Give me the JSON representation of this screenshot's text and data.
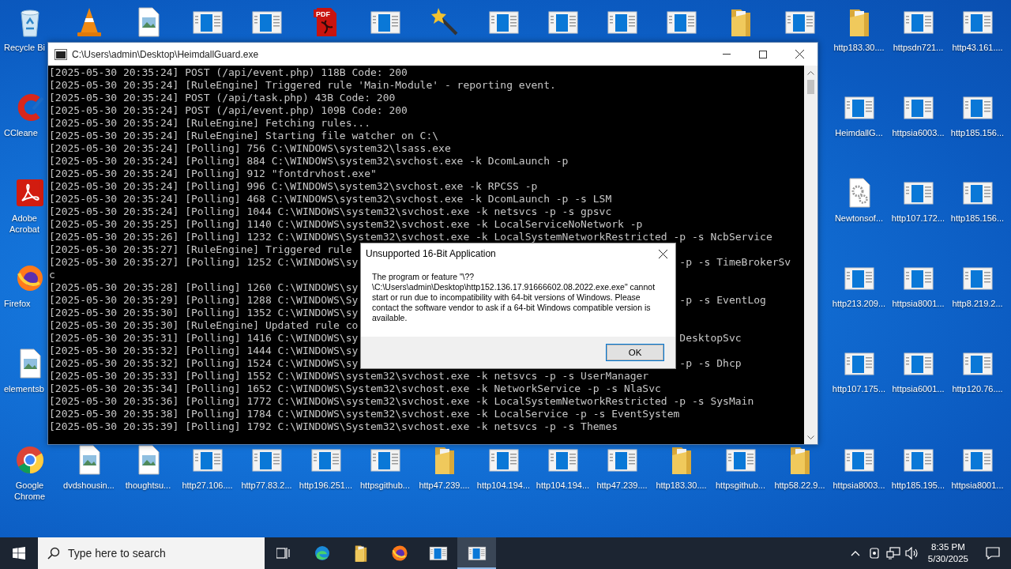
{
  "desktop": {
    "top_row": [
      {
        "kind": "recycle",
        "label": "Recycle Bi"
      },
      {
        "kind": "cone"
      },
      {
        "kind": "image"
      },
      {
        "kind": "app"
      },
      {
        "kind": "app"
      },
      {
        "kind": "pdf",
        "badge": "PDF"
      },
      {
        "kind": "app"
      },
      {
        "kind": "wand"
      },
      {
        "kind": "app"
      },
      {
        "kind": "app"
      },
      {
        "kind": "app"
      },
      {
        "kind": "app"
      },
      {
        "kind": "folder"
      },
      {
        "kind": "app"
      },
      {
        "kind": "folder",
        "label": "http183.30...."
      },
      {
        "kind": "app",
        "label": "httpsdn721..."
      },
      {
        "kind": "app",
        "label": "http43.161...."
      }
    ],
    "middle_rows": [
      {
        "left": {
          "kind": "cleaner",
          "label": "CCleane"
        },
        "right": [
          {
            "kind": "app",
            "label": "HeimdallG..."
          },
          {
            "kind": "app",
            "label": "httpsia6003..."
          },
          {
            "kind": "app",
            "label": "http185.156..."
          }
        ]
      },
      {
        "left": {
          "kind": "reader",
          "label": "Adobe Acrobat"
        },
        "right": [
          {
            "kind": "gear",
            "label": "Newtonsof..."
          },
          {
            "kind": "app",
            "label": "http107.172..."
          },
          {
            "kind": "app",
            "label": "http185.156..."
          }
        ]
      },
      {
        "left": {
          "kind": "firefox",
          "label": "Firefox"
        },
        "right": [
          {
            "kind": "app",
            "label": "http213.209..."
          },
          {
            "kind": "app",
            "label": "httpsia8001..."
          },
          {
            "kind": "app",
            "label": "http8.219.2..."
          }
        ]
      },
      {
        "left": {
          "kind": "image",
          "label": "elementsb"
        },
        "right": [
          {
            "kind": "app",
            "label": "http107.175..."
          },
          {
            "kind": "app",
            "label": "httpsia6001..."
          },
          {
            "kind": "app",
            "label": "http120.76...."
          }
        ]
      }
    ],
    "bottom_row": [
      {
        "kind": "chrome",
        "label": "Google Chrome"
      },
      {
        "kind": "image",
        "label": "dvdshousin..."
      },
      {
        "kind": "image",
        "label": "thoughtsu..."
      },
      {
        "kind": "app",
        "label": "http27.106...."
      },
      {
        "kind": "app",
        "label": "http77.83.2..."
      },
      {
        "kind": "app",
        "label": "http196.251..."
      },
      {
        "kind": "app",
        "label": "httpsgithub..."
      },
      {
        "kind": "folder",
        "label": "http47.239...."
      },
      {
        "kind": "app",
        "label": "http104.194..."
      },
      {
        "kind": "app",
        "label": "http104.194..."
      },
      {
        "kind": "app",
        "label": "http47.239...."
      },
      {
        "kind": "folder",
        "label": "http183.30...."
      },
      {
        "kind": "app",
        "label": "httpsgithub..."
      },
      {
        "kind": "folder",
        "label": "http58.22.9..."
      },
      {
        "kind": "app",
        "label": "httpsia8003..."
      },
      {
        "kind": "app",
        "label": "http185.195..."
      },
      {
        "kind": "app",
        "label": "httpsia8001..."
      }
    ]
  },
  "console": {
    "title": "C:\\Users\\admin\\Desktop\\HeimdallGuard.exe",
    "lines": [
      {
        "text": "[2025-05-30 20:35:24] POST (/api/event.php) 118B Code: 200"
      },
      {
        "text": "[2025-05-30 20:35:24] [RuleEngine] Triggered rule 'Main-Module' - reporting event."
      },
      {
        "text": "[2025-05-30 20:35:24] POST (/api/task.php) 43B Code: 200"
      },
      {
        "text": "[2025-05-30 20:35:24] POST (/api/event.php) 109B Code: 200"
      },
      {
        "text": "[2025-05-30 20:35:24] [RuleEngine] Fetching rules..."
      },
      {
        "text": "[2025-05-30 20:35:24] [RuleEngine] Starting file watcher on C:\\"
      },
      {
        "text": "[2025-05-30 20:35:24] [Polling] 756 C:\\WINDOWS\\system32\\lsass.exe"
      },
      {
        "text": "[2025-05-30 20:35:24] [Polling] 884 C:\\WINDOWS\\system32\\svchost.exe -k DcomLaunch -p"
      },
      {
        "text": "[2025-05-30 20:35:24] [Polling] 912 \"fontdrvhost.exe\""
      },
      {
        "text": "[2025-05-30 20:35:24] [Polling] 996 C:\\WINDOWS\\system32\\svchost.exe -k RPCSS -p"
      },
      {
        "text": "[2025-05-30 20:35:24] [Polling] 468 C:\\WINDOWS\\system32\\svchost.exe -k DcomLaunch -p -s LSM"
      },
      {
        "text": "[2025-05-30 20:35:24] [Polling] 1044 C:\\WINDOWS\\system32\\svchost.exe -k netsvcs -p -s gpsvc"
      },
      {
        "text": "[2025-05-30 20:35:25] [Polling] 1140 C:\\WINDOWS\\system32\\svchost.exe -k LocalServiceNoNetwork -p"
      },
      {
        "text": "[2025-05-30 20:35:26] [Polling] 1232 C:\\WINDOWS\\System32\\svchost.exe -k LocalSystemNetworkRestricted -p -s NcbService"
      },
      {
        "text": "[2025-05-30 20:35:27] [RuleEngine] Triggered rule"
      },
      {
        "text": "[2025-05-30 20:35:27] [Polling] 1252 C:\\WINDOWS\\sy",
        "tail": "-p -s TimeBrokerSv"
      },
      {
        "text": "c"
      },
      {
        "text": "[2025-05-30 20:35:28] [Polling] 1260 C:\\WINDOWS\\sy"
      },
      {
        "text": "[2025-05-30 20:35:29] [Polling] 1288 C:\\WINDOWS\\Sy",
        "tail": "-p -s EventLog"
      },
      {
        "text": "[2025-05-30 20:35:30] [Polling] 1352 C:\\WINDOWS\\sy"
      },
      {
        "text": "[2025-05-30 20:35:30] [RuleEngine] Updated rule co"
      },
      {
        "text": "[2025-05-30 20:35:31] [Polling] 1416 C:\\WINDOWS\\sy",
        "tail": "DesktopSvc"
      },
      {
        "text": "[2025-05-30 20:35:32] [Polling] 1444 C:\\WINDOWS\\sy"
      },
      {
        "text": "[2025-05-30 20:35:32] [Polling] 1524 C:\\WINDOWS\\sy",
        "tail": "-p -s Dhcp"
      },
      {
        "text": "[2025-05-30 20:35:33] [Polling] 1552 C:\\WINDOWS\\system32\\svchost.exe -k netsvcs -p -s UserManager"
      },
      {
        "text": "[2025-05-30 20:35:34] [Polling] 1652 C:\\WINDOWS\\System32\\svchost.exe -k NetworkService -p -s NlaSvc"
      },
      {
        "text": "[2025-05-30 20:35:36] [Polling] 1772 C:\\WINDOWS\\system32\\svchost.exe -k LocalSystemNetworkRestricted -p -s SysMain"
      },
      {
        "text": "[2025-05-30 20:35:38] [Polling] 1784 C:\\WINDOWS\\system32\\svchost.exe -k LocalService -p -s EventSystem"
      },
      {
        "text": "[2025-05-30 20:35:39] [Polling] 1792 C:\\WINDOWS\\System32\\svchost.exe -k netsvcs -p -s Themes"
      }
    ]
  },
  "dialog": {
    "title": "Unsupported 16-Bit Application",
    "message": "The program or feature \"\\??\\C:\\Users\\admin\\Desktop\\http152.136.17.91666602.08.2022.exe.exe\" cannot start or run due to incompatibility with 64-bit versions of Windows. Please contact the software vendor to ask if a 64-bit Windows compatible version is available.",
    "button": "OK"
  },
  "taskbar": {
    "search": {
      "placeholder": "Type here to search"
    },
    "apps": [
      {
        "kind": "edge",
        "active": false
      },
      {
        "kind": "folder",
        "active": false
      },
      {
        "kind": "firefox",
        "active": false
      },
      {
        "kind": "app",
        "active": false
      },
      {
        "kind": "app",
        "active": true
      }
    ],
    "clock": {
      "time": "8:35 PM",
      "date": "5/30/2025"
    }
  }
}
